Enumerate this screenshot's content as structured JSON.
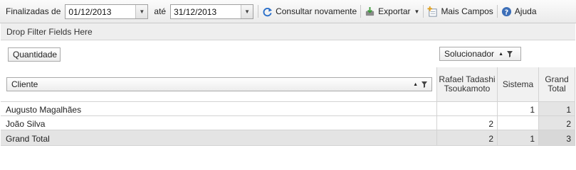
{
  "toolbar": {
    "finalized_from_label": "Finalizadas de",
    "date_from": "01/12/2013",
    "until_label": "até",
    "date_to": "31/12/2013",
    "refresh_label": "Consultar novamente",
    "export_label": "Exportar",
    "more_fields_label": "Mais Campos",
    "help_label": "Ajuda"
  },
  "filter_area": {
    "label": "Drop Filter Fields Here"
  },
  "data_field": {
    "label": "Quantidade"
  },
  "column_field": {
    "label": "Solucionador"
  },
  "row_field": {
    "label": "Cliente"
  },
  "columns": [
    "Rafael Tadashi Tsoukamoto",
    "Sistema",
    "Grand Total"
  ],
  "rows": [
    {
      "label": "Augusto Magalhães",
      "values": [
        "",
        "1",
        "1"
      ]
    },
    {
      "label": "João Silva",
      "values": [
        "2",
        "",
        "2"
      ]
    }
  ],
  "grand_total": {
    "label": "Grand Total",
    "values": [
      "2",
      "1",
      "3"
    ]
  },
  "colors": {
    "accent_blue": "#2a6fc9",
    "grand_total_bg": "#e4e4e4"
  }
}
